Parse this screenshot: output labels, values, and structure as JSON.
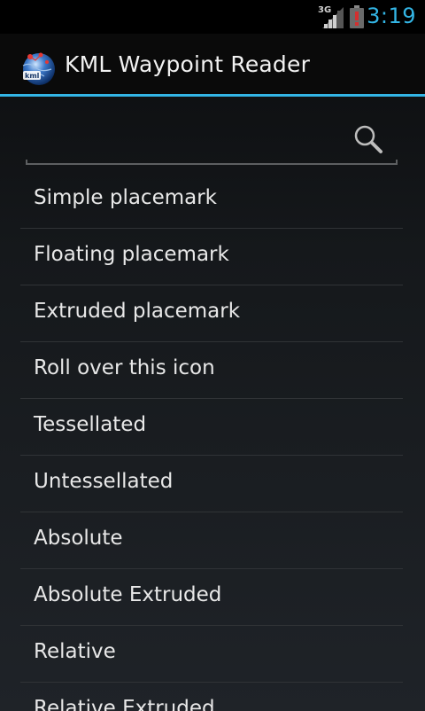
{
  "status_bar": {
    "network": "3G",
    "time": "3:19",
    "signal_icon": "signal-bars-icon",
    "battery_icon": "battery-alert-icon",
    "battery_color": "#d32f2f",
    "time_color": "#33b5e5"
  },
  "action_bar": {
    "title": "KML Waypoint Reader",
    "app_icon": "kml-app-icon",
    "accent": "#33b5e5"
  },
  "search": {
    "value": "",
    "placeholder": "",
    "icon": "search-icon"
  },
  "list": {
    "items": [
      {
        "label": "Simple placemark"
      },
      {
        "label": "Floating placemark"
      },
      {
        "label": "Extruded placemark"
      },
      {
        "label": "Roll over this icon"
      },
      {
        "label": "Tessellated"
      },
      {
        "label": "Untessellated"
      },
      {
        "label": "Absolute"
      },
      {
        "label": "Absolute Extruded"
      },
      {
        "label": "Relative"
      },
      {
        "label": "Relative Extruded"
      }
    ]
  }
}
